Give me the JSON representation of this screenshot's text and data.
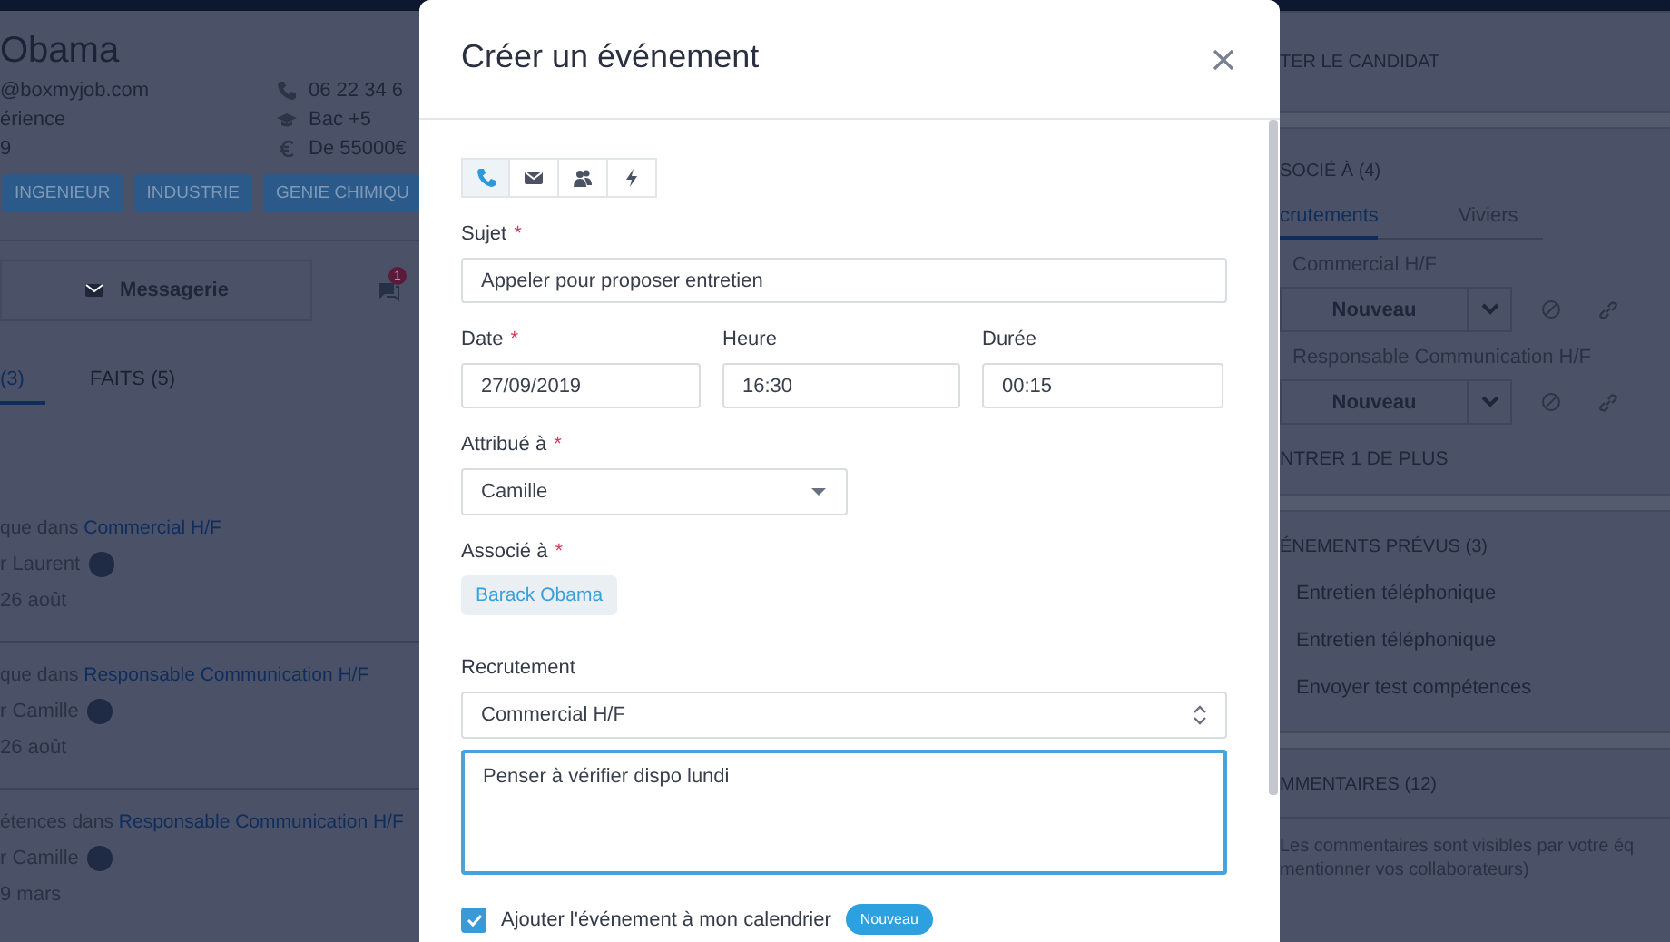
{
  "left_panel": {
    "name": "Obama",
    "details": [
      {
        "text": "@boxmyjob.com",
        "kind": "phone",
        "value": "06 22 34 6"
      },
      {
        "text": "érience",
        "kind": "diploma",
        "value": "Bac +5"
      },
      {
        "text": "9",
        "kind": "salary",
        "value": "De 55000€"
      }
    ],
    "tags": [
      "INGENIEUR",
      "INDUSTRIE",
      "GENIE CHIMIQU"
    ],
    "messaging_button": "Messagerie",
    "notification_badge": "1",
    "tabs": [
      {
        "label": "(3)",
        "selected": true
      },
      {
        "label": "FAITS (5)",
        "selected": false
      }
    ],
    "activities": [
      {
        "text": "que dans ",
        "link": "Commercial H/F",
        "author": "r Laurent",
        "date": "26 août"
      },
      {
        "text": "que dans ",
        "link": "Responsable Communication H/F",
        "author": "r Camille",
        "date": "26 août"
      },
      {
        "text": "étences dans ",
        "link": "Responsable Communication H/F",
        "author": "r Camille",
        "date": "9 mars"
      }
    ]
  },
  "modal": {
    "title": "Créer un événement",
    "event_types": [
      {
        "kind": "phone",
        "selected": true
      },
      {
        "kind": "mail",
        "selected": false
      },
      {
        "kind": "meeting",
        "selected": false
      },
      {
        "kind": "action",
        "selected": false
      }
    ],
    "subject": {
      "label": "Sujet",
      "required_mark": "*",
      "value": "Appeler pour proposer entretien"
    },
    "date": {
      "label": "Date",
      "required_mark": "*",
      "value": "27/09/2019"
    },
    "time": {
      "label": "Heure",
      "value": "16:30"
    },
    "duration": {
      "label": "Durée",
      "value": "00:15"
    },
    "assigned_to": {
      "label": "Attribué à",
      "required_mark": "*",
      "value": "Camille"
    },
    "associated_with": {
      "label": "Associé à",
      "required_mark": "*",
      "chips": [
        "Barack Obama"
      ]
    },
    "recruitment": {
      "label": "Recrutement",
      "value": "Commercial H/F"
    },
    "notes": {
      "value": "Penser à vérifier dispo lundi",
      "focused": true
    },
    "calendar_option": {
      "label": "Ajouter l'événement à mon calendrier",
      "checked": true,
      "badge": "Nouveau"
    }
  },
  "right_panel": {
    "header": "TER LE CANDIDAT",
    "associated_title": "SOCIÉ À (4)",
    "tabs": [
      {
        "label": "crutements",
        "selected": true
      },
      {
        "label": "Viviers",
        "selected": false
      }
    ],
    "pipelines": [
      {
        "title": "Commercial H/F",
        "status": "Nouveau"
      },
      {
        "title": "Responsable Communication H/F",
        "status": "Nouveau"
      }
    ],
    "show_more": "NTRER 1 DE PLUS",
    "events_title": "ÉNEMENTS PRÉVUS (3)",
    "events": [
      "Entretien téléphonique",
      "Entretien téléphonique",
      "Envoyer test compétences"
    ],
    "comments_title": "MMENTAIRES (12)",
    "comments_note": [
      "Les commentaires sont visibles par votre éq",
      "mentionner vos collaborateurs)"
    ]
  }
}
